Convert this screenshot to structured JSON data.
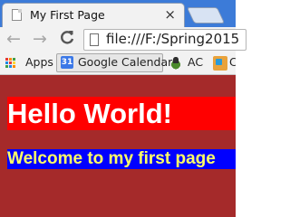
{
  "browser": {
    "tab": {
      "title": "My First Page",
      "close_glyph": "×",
      "favicon": "page-icon"
    },
    "toolbar": {
      "back_glyph": "←",
      "forward_glyph": "→",
      "reload_glyph": "C",
      "url": "file:///F:/Spring2015"
    },
    "bookmarks": [
      {
        "label": "Apps",
        "icon": "apps-grid-icon"
      },
      {
        "label": "Google Calendar",
        "icon": "google-calendar-icon",
        "icon_text": "31"
      },
      {
        "label": "AC",
        "icon": "ac-icon"
      },
      {
        "label": "C",
        "icon": "bookmark-icon"
      }
    ],
    "colors": {
      "tabstrip": "#3c7bd8",
      "toolbar": "#f2f2f2"
    }
  },
  "page": {
    "heading": "Hello World!",
    "subheading": "Welcome to my first page",
    "colors": {
      "background": "#a52a2a",
      "heading_bg": "#ff0000",
      "heading_text": "#ffffff",
      "subheading_bg": "#0000ff",
      "subheading_text": "#ffff66"
    }
  }
}
